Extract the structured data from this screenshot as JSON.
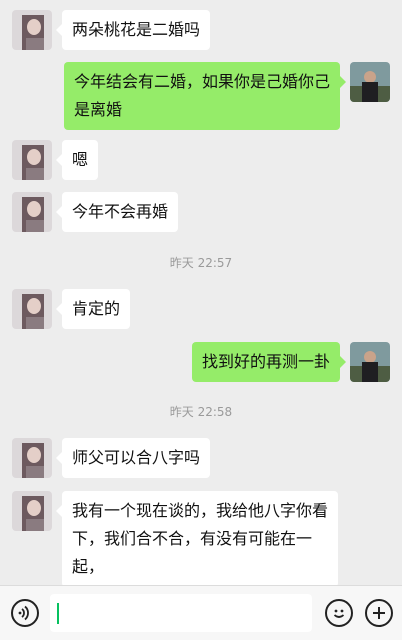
{
  "messages": [
    {
      "side": "in",
      "text": "两朵桃花是二婚吗"
    },
    {
      "side": "out",
      "text": "今年结会有二婚，如果你是己婚你己是离婚"
    },
    {
      "side": "in",
      "text": "嗯"
    },
    {
      "side": "in",
      "text": "今年不会再婚"
    },
    {
      "side": "in",
      "text": "肯定的"
    },
    {
      "side": "out",
      "text": "找到好的再测一卦"
    },
    {
      "side": "in",
      "text": "师父可以合八字吗"
    },
    {
      "side": "in",
      "text": "我有一个现在谈的，我给他八字你看下，我们合不合，有没有可能在一起，"
    }
  ],
  "timestamps": [
    "昨天 22:57",
    "昨天 22:58"
  ],
  "colors": {
    "background": "#ededed",
    "outgoing_bubble": "#95ec69",
    "incoming_bubble": "#ffffff",
    "cursor": "#07c160"
  },
  "icons": {
    "voice": "voice-icon",
    "emoji": "emoji-icon",
    "plus": "plus-icon"
  },
  "input": {
    "value": ""
  }
}
